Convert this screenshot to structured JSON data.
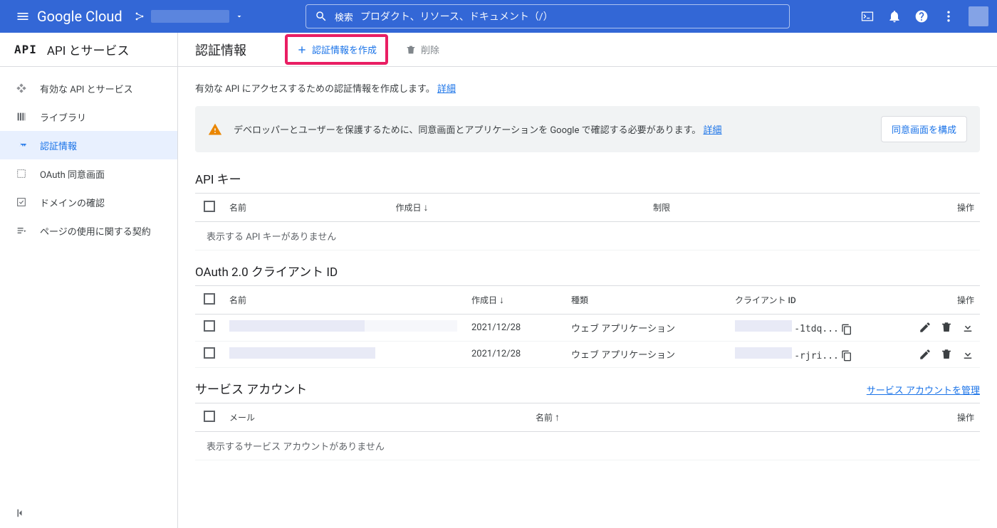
{
  "header": {
    "logo": "Google Cloud",
    "search_label": "検索",
    "search_placeholder": "プロダクト、リソース、ドキュメント（/）"
  },
  "sidebar": {
    "app_logo": "API",
    "app_title": "API とサービス",
    "items": [
      {
        "label": "有効な API とサービス"
      },
      {
        "label": "ライブラリ"
      },
      {
        "label": "認証情報"
      },
      {
        "label": "OAuth 同意画面"
      },
      {
        "label": "ドメインの確認"
      },
      {
        "label": "ページの使用に関する契約"
      }
    ]
  },
  "toolbar": {
    "page_title": "認証情報",
    "create_label": "認証情報を作成",
    "delete_label": "削除"
  },
  "description": {
    "text": "有効な API にアクセスするための認証情報を作成します。",
    "link": "詳細"
  },
  "banner": {
    "text": "デベロッパーとユーザーを保護するために、同意画面とアプリケーションを Google で確認する必要があります。",
    "link": "詳細",
    "button": "同意画面を構成"
  },
  "api_keys": {
    "title": "API キー",
    "columns": {
      "name": "名前",
      "created": "作成日",
      "restriction": "制限",
      "ops": "操作"
    },
    "empty": "表示する API キーがありません"
  },
  "oauth": {
    "title": "OAuth 2.0 クライアント ID",
    "columns": {
      "name": "名前",
      "created": "作成日",
      "type": "種類",
      "client_id": "クライアント ID",
      "ops": "操作"
    },
    "rows": [
      {
        "created": "2021/12/28",
        "type": "ウェブ アプリケーション",
        "client_id_suffix": "-1tdq..."
      },
      {
        "created": "2021/12/28",
        "type": "ウェブ アプリケーション",
        "client_id_suffix": "-rjri..."
      }
    ]
  },
  "service_accounts": {
    "title": "サービス アカウント",
    "manage_link": "サービス アカウントを管理",
    "columns": {
      "email": "メール",
      "name": "名前",
      "ops": "操作"
    },
    "empty": "表示するサービス アカウントがありません"
  }
}
